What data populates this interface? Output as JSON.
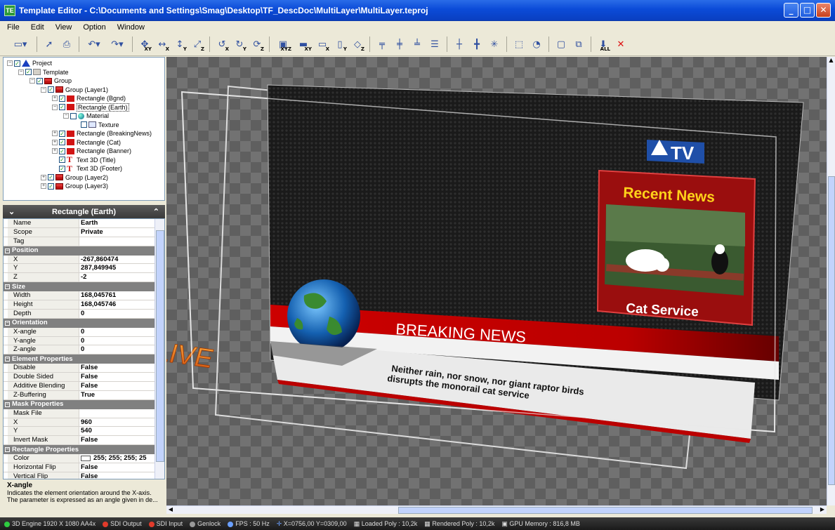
{
  "window": {
    "title": "Template Editor - C:\\Documents and Settings\\Smag\\Desktop\\TF_DescDoc\\MultiLayer\\MultiLayer.teproj"
  },
  "menu": [
    "File",
    "Edit",
    "View",
    "Option",
    "Window"
  ],
  "toolbar": {
    "subs": [
      "XY",
      "X",
      "Y",
      "Z",
      "X",
      "Y",
      "Z",
      "XYZ",
      "XY",
      "X",
      "Y",
      "Z",
      "ALL"
    ]
  },
  "tree": {
    "project": "Project",
    "template": "Template",
    "group": "Group",
    "layer1": "Group (Layer1)",
    "bgnd": "Rectangle (Bgnd)",
    "earth": "Rectangle (Earth)",
    "material": "Material",
    "texture": "Texture",
    "breaking": "Rectangle (BreakingNews)",
    "cat": "Rectangle (Cat)",
    "banner": "Rectangle (Banner)",
    "title": "Text 3D (Title)",
    "footer": "Text 3D (Footer)",
    "layer2": "Group (Layer2)",
    "layer3": "Group (Layer3)"
  },
  "props": {
    "header": "Rectangle (Earth)",
    "name_k": "Name",
    "name_v": "Earth",
    "scope_k": "Scope",
    "scope_v": "Private",
    "tag_k": "Tag",
    "position": "Position",
    "x_k": "X",
    "x_v": "-267,860474",
    "y_k": "Y",
    "y_v": "287,849945",
    "z_k": "Z",
    "z_v": "-2",
    "size": "Size",
    "width_k": "Width",
    "width_v": "168,045761",
    "height_k": "Height",
    "height_v": "168,045746",
    "depth_k": "Depth",
    "depth_v": "0",
    "orientation": "Orientation",
    "xa_k": "X-angle",
    "xa_v": "0",
    "ya_k": "Y-angle",
    "ya_v": "0",
    "za_k": "Z-angle",
    "za_v": "0",
    "element": "Element Properties",
    "disable_k": "Disable",
    "disable_v": "False",
    "double_k": "Double Sided",
    "double_v": "False",
    "additive_k": "Additive Blending",
    "additive_v": "False",
    "zbuf_k": "Z-Buffering",
    "zbuf_v": "True",
    "mask": "Mask Properties",
    "maskfile_k": "Mask File",
    "mx_k": "X",
    "mx_v": "960",
    "my_k": "Y",
    "my_v": "540",
    "invert_k": "Invert Mask",
    "invert_v": "False",
    "rect": "Rectangle Properties",
    "color_k": "Color",
    "color_v": "255; 255; 255; 25",
    "hflip_k": "Horizontal Flip",
    "hflip_v": "False",
    "vflip_k": "Vertical Flip",
    "vflip_v": "False"
  },
  "help": {
    "title": "X-angle",
    "line1": "Indicates the element orientation around the X-axis.",
    "line2": "The parameter is expressed as an angle given in de..."
  },
  "scene": {
    "logo": "TV",
    "recent": "Recent News",
    "catservice": "Cat Service",
    "breaking": "BREAKING NEWS",
    "ticker1": "Neither rain, nor snow, nor giant raptor birds",
    "ticker2": "disrupts the monorail cat service",
    "live": "LIVE"
  },
  "status": {
    "engine": "3D Engine 1920 X 1080  AA4x",
    "sdiout": "SDI Output",
    "sdiin": "SDI Input",
    "genlock": "Genlock",
    "fps": "FPS : 50 Hz",
    "coords": "X=0756,00 Y=0309,00",
    "loaded": "Loaded Poly : 10,2k",
    "rendered": "Rendered Poly : 10,2k",
    "gpu": "GPU Memory : 816,8 MB"
  }
}
